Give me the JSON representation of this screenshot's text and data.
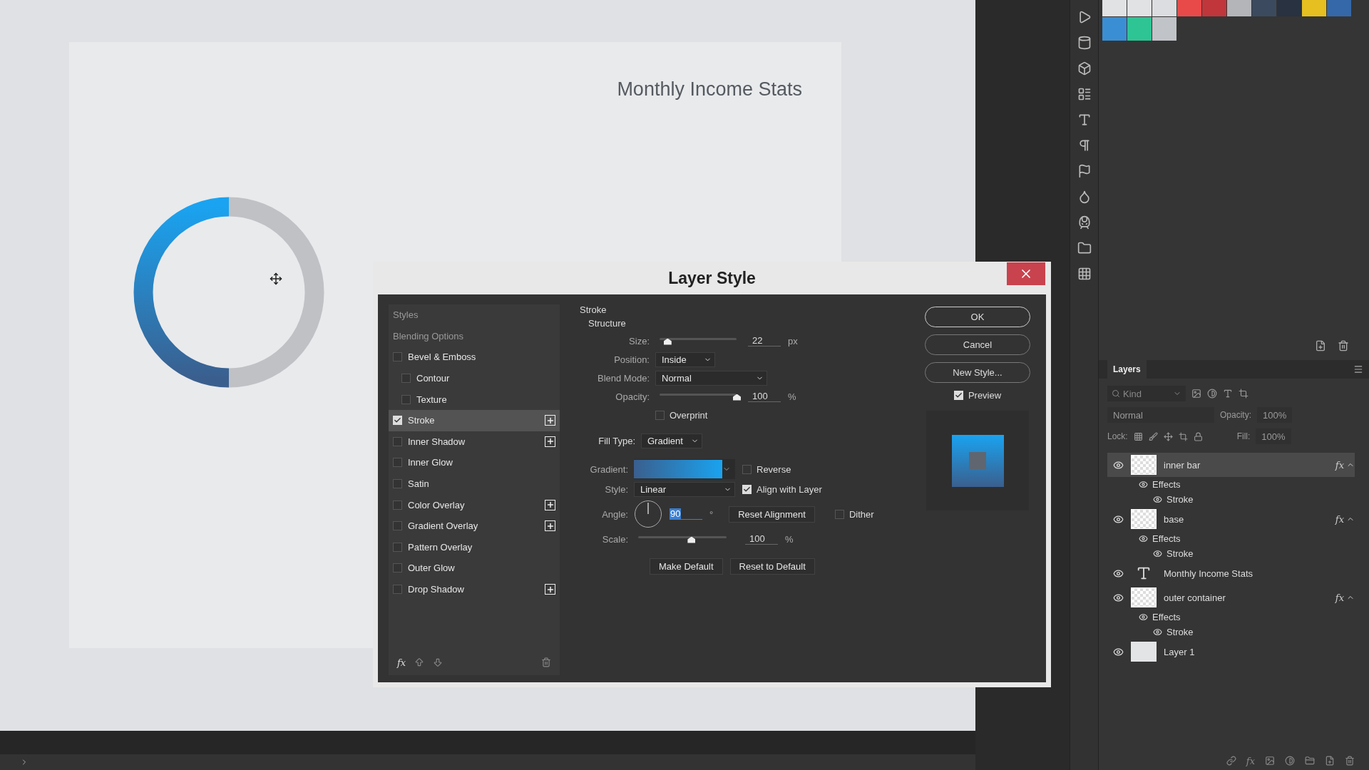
{
  "canvas": {
    "title": "Monthly Income Stats"
  },
  "dialog": {
    "title": "Layer Style",
    "styles": [
      {
        "label": "Styles",
        "kind": "header"
      },
      {
        "label": "Blending Options",
        "kind": "header"
      },
      {
        "label": "Bevel & Emboss",
        "kind": "effect",
        "checked": false,
        "selected": false,
        "addable": false,
        "children": [
          {
            "label": "Contour",
            "kind": "effect",
            "checked": false,
            "selected": false,
            "addable": false
          },
          {
            "label": "Texture",
            "kind": "effect",
            "checked": false,
            "selected": false,
            "addable": false
          }
        ]
      },
      {
        "label": "Stroke",
        "kind": "effect",
        "checked": true,
        "selected": true,
        "addable": true
      },
      {
        "label": "Inner Shadow",
        "kind": "effect",
        "checked": false,
        "selected": false,
        "addable": true
      },
      {
        "label": "Inner Glow",
        "kind": "effect",
        "checked": false,
        "selected": false,
        "addable": false
      },
      {
        "label": "Satin",
        "kind": "effect",
        "checked": false,
        "selected": false,
        "addable": false
      },
      {
        "label": "Color Overlay",
        "kind": "effect",
        "checked": false,
        "selected": false,
        "addable": true
      },
      {
        "label": "Gradient Overlay",
        "kind": "effect",
        "checked": false,
        "selected": false,
        "addable": true
      },
      {
        "label": "Pattern Overlay",
        "kind": "effect",
        "checked": false,
        "selected": false,
        "addable": false
      },
      {
        "label": "Outer Glow",
        "kind": "effect",
        "checked": false,
        "selected": false,
        "addable": false
      },
      {
        "label": "Drop Shadow",
        "kind": "effect",
        "checked": false,
        "selected": false,
        "addable": true
      }
    ],
    "footer_fx": "fx",
    "stroke": {
      "title": "Stroke",
      "group": "Structure",
      "size": {
        "label": "Size:",
        "value": "22",
        "unit": "px",
        "level": 0.1
      },
      "position": {
        "label": "Position:",
        "value": "Inside"
      },
      "blend_mode": {
        "label": "Blend Mode:",
        "value": "Normal"
      },
      "opacity": {
        "label": "Opacity:",
        "value": "100",
        "unit": "%",
        "level": 1
      },
      "overprint": {
        "label": "Overprint",
        "checked": false
      },
      "fill_type": {
        "label": "Fill Type:",
        "value": "Gradient"
      },
      "gradient": {
        "label": "Gradient:"
      },
      "reverse": {
        "label": "Reverse",
        "checked": false
      },
      "style": {
        "label": "Style:",
        "value": "Linear"
      },
      "align": {
        "label": "Align with Layer",
        "checked": true
      },
      "angle": {
        "label": "Angle:",
        "value": "90",
        "unit": "°"
      },
      "reset_alignment": "Reset Alignment",
      "dither": {
        "label": "Dither",
        "checked": false
      },
      "scale": {
        "label": "Scale:",
        "value": "100",
        "unit": "%",
        "level": 0.6
      },
      "buttons": [
        "Make Default",
        "Reset to Default"
      ]
    },
    "buttons": [
      {
        "label": "OK",
        "default": true
      },
      {
        "label": "Cancel",
        "default": false
      },
      {
        "label": "New Style...",
        "default": false
      }
    ],
    "preview": {
      "label": "Preview",
      "checked": true
    }
  },
  "swatches": [
    {
      "color": "#e1e2e4"
    },
    {
      "color": "#e1e2e4"
    },
    {
      "color": "#dcdde0"
    },
    {
      "color": "#e84a4a"
    },
    {
      "color": "#c0363b"
    },
    {
      "color": "#b3b5b9"
    },
    {
      "color": "#3b4a5e"
    },
    {
      "color": "#283240"
    },
    {
      "color": "#e5c020"
    },
    {
      "color": "#3568a8"
    },
    {
      "color": "#3a8fd4"
    },
    {
      "color": "#2ec493"
    },
    {
      "color": "#c0c3c8"
    }
  ],
  "layers_panel": {
    "tab": "Layers",
    "filter": {
      "placeholder": "Kind"
    },
    "blend_mode": {
      "value": "Normal",
      "disabled": true
    },
    "opacity": {
      "label": "Opacity:",
      "value": "100%",
      "disabled": true
    },
    "lock_label": "Lock:",
    "fill": {
      "label": "Fill:",
      "value": "100%",
      "disabled": true
    },
    "layers": [
      {
        "name": "inner bar",
        "kind": "shape",
        "selected": true,
        "fx": "fx",
        "children": [
          {
            "name": "Effects",
            "children": [
              {
                "name": "Stroke"
              }
            ]
          }
        ]
      },
      {
        "name": "base",
        "kind": "shape",
        "selected": false,
        "fx": "fx",
        "children": [
          {
            "name": "Effects",
            "children": [
              {
                "name": "Stroke"
              }
            ]
          }
        ]
      },
      {
        "name": "Monthly Income Stats",
        "kind": "text",
        "selected": false
      },
      {
        "name": "outer container",
        "kind": "shape",
        "selected": false,
        "fx": "fx",
        "children": [
          {
            "name": "Effects",
            "children": [
              {
                "name": "Stroke"
              }
            ]
          }
        ]
      },
      {
        "name": "Layer 1",
        "kind": "pixel",
        "selected": false
      }
    ],
    "footer_fx": "fx"
  }
}
